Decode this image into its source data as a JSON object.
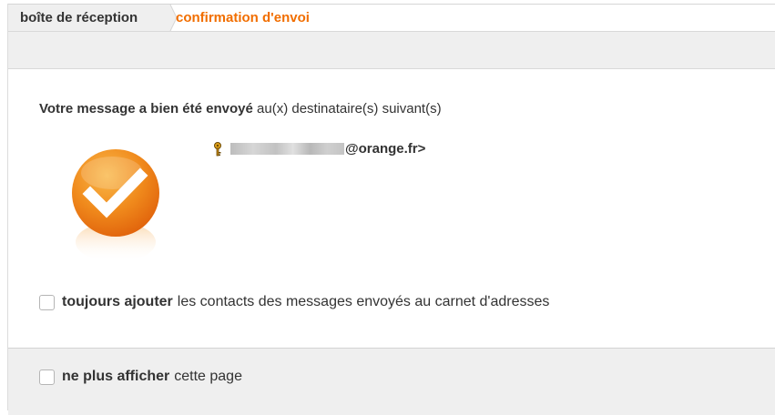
{
  "breadcrumb": {
    "home_label": "boîte de réception",
    "current_label": "confirmation d'envoi"
  },
  "confirmation": {
    "message_bold": "Votre message a bien été envoyé",
    "message_rest": "au(x) destinataire(s) suivant(s)",
    "recipient_suffix": "@orange.fr>"
  },
  "options": {
    "always_add_bold": "toujours ajouter",
    "always_add_rest": "les contacts des messages envoyés au carnet d'adresses",
    "no_more_bold": "ne plus afficher",
    "no_more_rest": "cette page"
  },
  "colors": {
    "accent": "#f16e00",
    "panel": "#efefef"
  },
  "icons": [
    "success-check-icon",
    "key-icon",
    "checkbox"
  ]
}
